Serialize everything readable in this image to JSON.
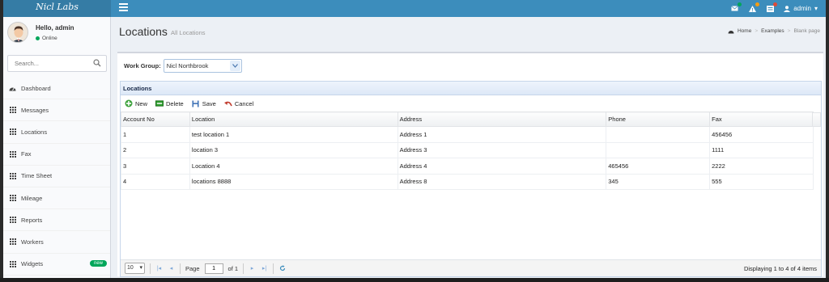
{
  "app": {
    "logo": "Nicl Labs"
  },
  "header": {
    "user_label": "admin",
    "badge_colors": [
      "#00a65a",
      "#f39c12",
      "#dd4b39"
    ]
  },
  "sidebar": {
    "user": {
      "greeting": "Hello, admin",
      "status": "Online"
    },
    "search_placeholder": "Search...",
    "items": [
      {
        "label": "Dashboard",
        "icon": "dashboard-icon"
      },
      {
        "label": "Messages",
        "icon": "grid-icon"
      },
      {
        "label": "Locations",
        "icon": "grid-icon"
      },
      {
        "label": "Fax",
        "icon": "grid-icon"
      },
      {
        "label": "Time Sheet",
        "icon": "grid-icon"
      },
      {
        "label": "Mileage",
        "icon": "grid-icon"
      },
      {
        "label": "Reports",
        "icon": "grid-icon"
      },
      {
        "label": "Workers",
        "icon": "grid-icon"
      },
      {
        "label": "Widgets",
        "icon": "grid-icon",
        "badge": "new"
      }
    ]
  },
  "content": {
    "title": "Locations",
    "subtitle": "All Locations",
    "breadcrumb": [
      "Home",
      "Examples",
      "Blank page"
    ]
  },
  "workgroup": {
    "label": "Work Group:",
    "value": "Nicl Northbrook"
  },
  "grid": {
    "title": "Locations",
    "toolbar": {
      "new": "New",
      "delete": "Delete",
      "save": "Save",
      "cancel": "Cancel"
    },
    "columns": [
      "Account No",
      "Location",
      "Address",
      "Phone",
      "Fax"
    ],
    "rows": [
      [
        "1",
        "test location 1",
        "Address 1",
        "",
        "456456"
      ],
      [
        "2",
        "location 3",
        "Address 3",
        "",
        "1111"
      ],
      [
        "3",
        "Location 4",
        "Address 4",
        "465456",
        "2222"
      ],
      [
        "4",
        "locations 8888",
        "Address 8",
        "345",
        "555"
      ]
    ]
  },
  "pager": {
    "page_size": "10",
    "page_label": "Page",
    "page_value": "1",
    "of_label": "of 1",
    "info": "Displaying 1 to 4 of 4 items"
  }
}
